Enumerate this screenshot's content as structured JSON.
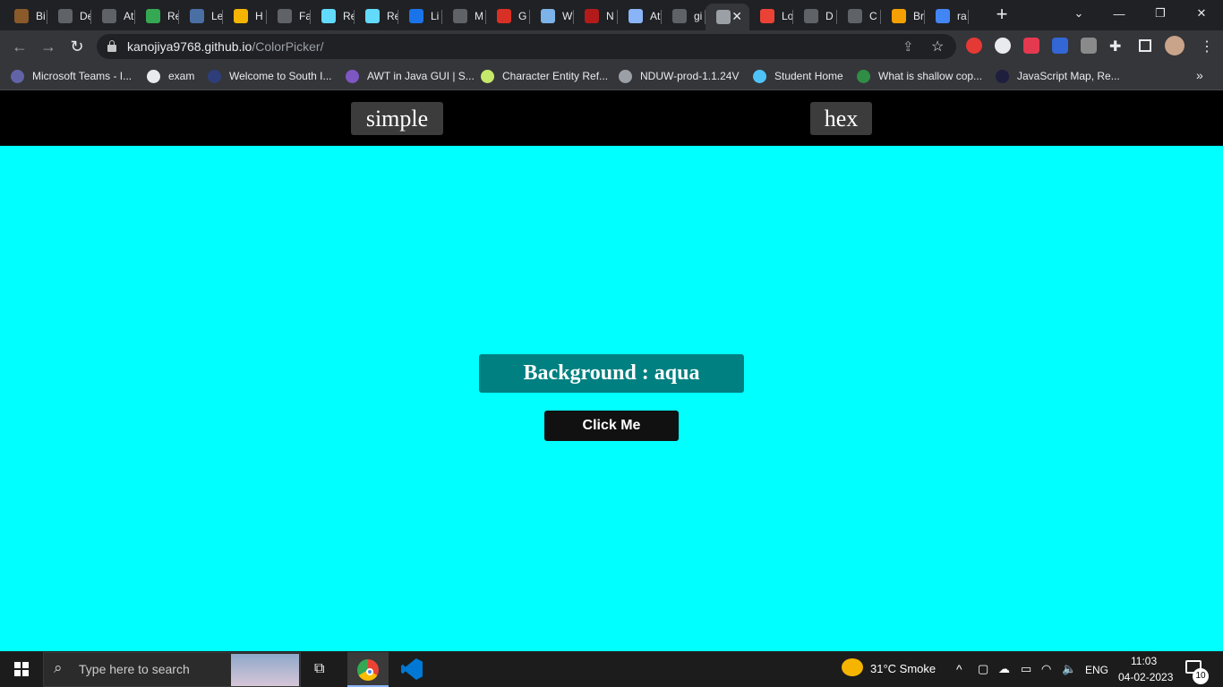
{
  "browser": {
    "tabs": [
      {
        "label": "Bi",
        "color": "#8a5a2b"
      },
      {
        "label": "De",
        "color": "#5f6368"
      },
      {
        "label": "At",
        "color": "#5f6368"
      },
      {
        "label": "Re",
        "color": "#34a853"
      },
      {
        "label": "Le",
        "color": "#4a6fa5"
      },
      {
        "label": "H",
        "color": "#f4b400"
      },
      {
        "label": "Fa",
        "color": "#5f6368"
      },
      {
        "label": "Re",
        "color": "#61dafb"
      },
      {
        "label": "Re",
        "color": "#61dafb"
      },
      {
        "label": "Li",
        "color": "#1a73e8"
      },
      {
        "label": "M",
        "color": "#5f6368"
      },
      {
        "label": "G",
        "color": "#d93025"
      },
      {
        "label": "W",
        "color": "#7cb3e8"
      },
      {
        "label": "N",
        "color": "#b31b1b"
      },
      {
        "label": "At",
        "color": "#8ab4f8"
      },
      {
        "label": "gi",
        "color": "#5f6368"
      },
      {
        "label": "",
        "color": "#9aa0a6",
        "active": true
      },
      {
        "label": "Lo",
        "color": "#ea4335"
      },
      {
        "label": "D",
        "color": "#5f6368"
      },
      {
        "label": "C",
        "color": "#5f6368"
      },
      {
        "label": "Br",
        "color": "#f4a000"
      },
      {
        "label": "ra",
        "color": "#4285f4"
      }
    ],
    "url_host": "kanojiya9768.github.io",
    "url_path": "/ColorPicker/",
    "bookmarks": [
      {
        "label": "Microsoft Teams - I...",
        "color": "#6264a7"
      },
      {
        "label": "exam",
        "color": "#e8eaed"
      },
      {
        "label": "Welcome to South I...",
        "color": "#2d3e7a"
      },
      {
        "label": "AWT in Java GUI | S...",
        "color": "#7e57c2"
      },
      {
        "label": "Character Entity Ref...",
        "color": "#c6e86a"
      },
      {
        "label": "NDUW-prod-1.1.24V",
        "color": "#9aa0a6"
      },
      {
        "label": "Student Home",
        "color": "#4fc3f7"
      },
      {
        "label": "What is shallow cop...",
        "color": "#2f8d46"
      },
      {
        "label": "JavaScript Map, Re...",
        "color": "#1e1e3f"
      }
    ],
    "more_bookmarks": "»"
  },
  "page": {
    "nav": {
      "simple": "simple",
      "hex": "hex"
    },
    "background_label": "Background : aqua",
    "button_label": "Click Me",
    "colors": {
      "background": "#00ffff",
      "label_bg": "#008080",
      "nav_bg": "#000000",
      "nav_button_bg": "#3c3c3c"
    }
  },
  "taskbar": {
    "search_placeholder": "Type here to search",
    "weather": "31°C  Smoke",
    "language": "ENG",
    "time": "11:03",
    "date": "04-02-2023",
    "notifications": "10"
  }
}
